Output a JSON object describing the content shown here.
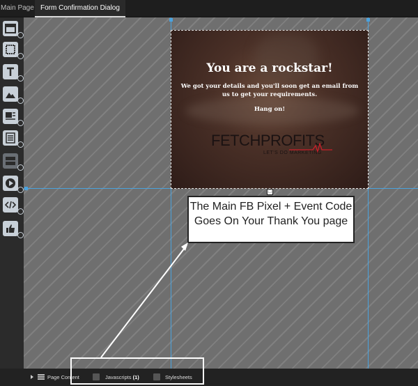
{
  "tabs": {
    "main": "Main Page",
    "dialog": "Form Confirmation Dialog"
  },
  "toolbar": {
    "tools": [
      "section-icon",
      "box-icon",
      "text-icon",
      "image-icon",
      "image-text-icon",
      "form-icon",
      "layout-icon",
      "video-icon",
      "code-icon",
      "like-icon"
    ]
  },
  "dialog": {
    "title": "You are a rockstar!",
    "message": "We got your details and you'll soon get an email from us to get your requirements.",
    "hang_on": "Hang on!",
    "logo_text": "FETCHPROFITS",
    "logo_tagline": "LET'S DO MARKETING"
  },
  "annotation": {
    "text": "The Main FB Pixel + Event Code Goes On Your Thank You page"
  },
  "bottom": {
    "page_content": "Page Content",
    "javascripts": "Javascripts",
    "javascripts_count": "(1)",
    "stylesheets": "Stylesheets"
  },
  "colors": {
    "guide": "#4aa3df",
    "accent_tool": "#c8d0d8"
  }
}
